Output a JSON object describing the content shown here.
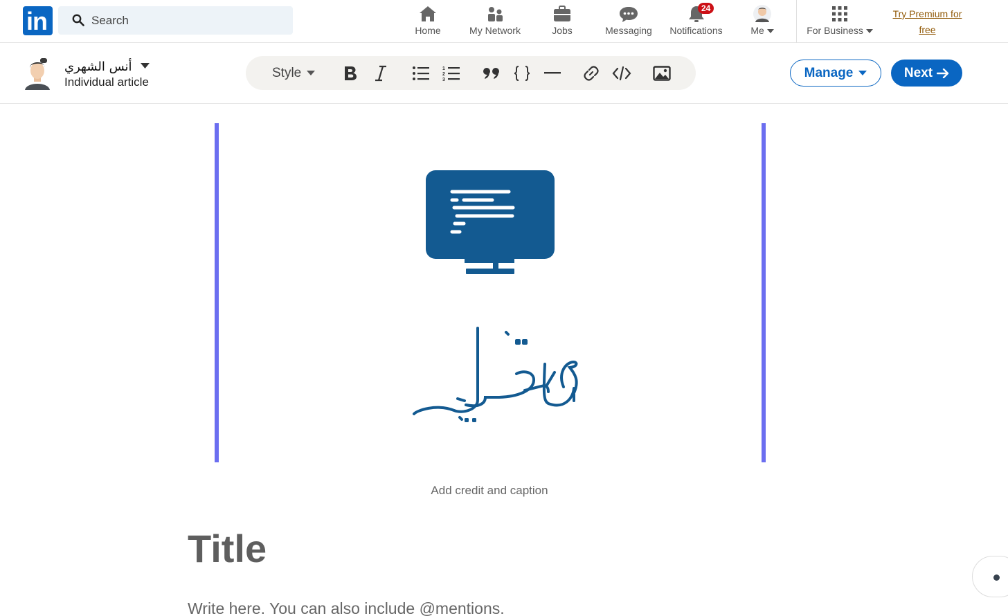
{
  "nav": {
    "logo_text": "in",
    "search_placeholder": "Search",
    "items": [
      {
        "label": "Home",
        "icon": "home-icon"
      },
      {
        "label": "My Network",
        "icon": "network-icon"
      },
      {
        "label": "Jobs",
        "icon": "briefcase-icon"
      },
      {
        "label": "Messaging",
        "icon": "messaging-icon"
      },
      {
        "label": "Notifications",
        "icon": "bell-icon",
        "badge": "24"
      },
      {
        "label": "Me",
        "icon": "avatar"
      },
      {
        "label": "For Business",
        "icon": "grid-icon"
      }
    ],
    "premium": "Try Premium for free"
  },
  "editor": {
    "author_name": "أنس الشهري",
    "author_sub": "Individual article",
    "style_label": "Style",
    "manage_label": "Manage",
    "next_label": "Next"
  },
  "article": {
    "cover_text": "قنديل",
    "caption_placeholder": "Add credit and caption",
    "title_placeholder": "Title",
    "body_placeholder": "Write here. You can also include @mentions."
  },
  "colors": {
    "brand": "#0a66c2",
    "cover_border": "#6b6ef0",
    "cover_icon": "#135a91",
    "badge": "#cc1016"
  }
}
